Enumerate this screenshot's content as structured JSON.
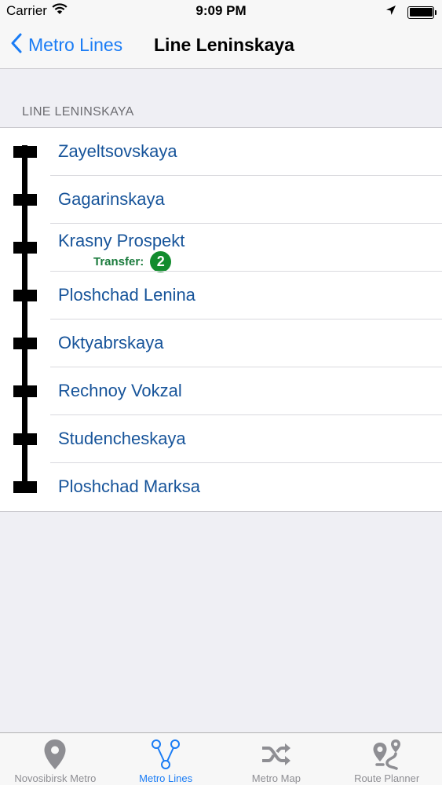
{
  "status_bar": {
    "carrier": "Carrier",
    "time": "9:09 PM"
  },
  "nav": {
    "back_label": "Metro Lines",
    "title": "Line Leninskaya"
  },
  "section": {
    "header": "LINE LENINSKAYA"
  },
  "stations": [
    {
      "name": "Zayeltsovskaya"
    },
    {
      "name": "Gagarinskaya"
    },
    {
      "name": "Krasny Prospekt",
      "transfer_label": "Transfer:",
      "transfer_line": "2"
    },
    {
      "name": "Ploshchad Lenina"
    },
    {
      "name": "Oktyabrskaya"
    },
    {
      "name": "Rechnoy Vokzal"
    },
    {
      "name": "Studencheskaya"
    },
    {
      "name": "Ploshchad Marksa"
    }
  ],
  "tabs": [
    {
      "label": "Novosibirsk Metro",
      "icon": "map-pin-icon"
    },
    {
      "label": "Metro Lines",
      "icon": "metro-lines-icon",
      "active": true
    },
    {
      "label": "Metro Map",
      "icon": "shuffle-icon"
    },
    {
      "label": "Route Planner",
      "icon": "route-icon"
    }
  ],
  "colors": {
    "accent": "#1a7cf5",
    "station_text": "#17549a",
    "transfer_text": "#1b7b3d",
    "transfer_badge": "#128c2e"
  }
}
